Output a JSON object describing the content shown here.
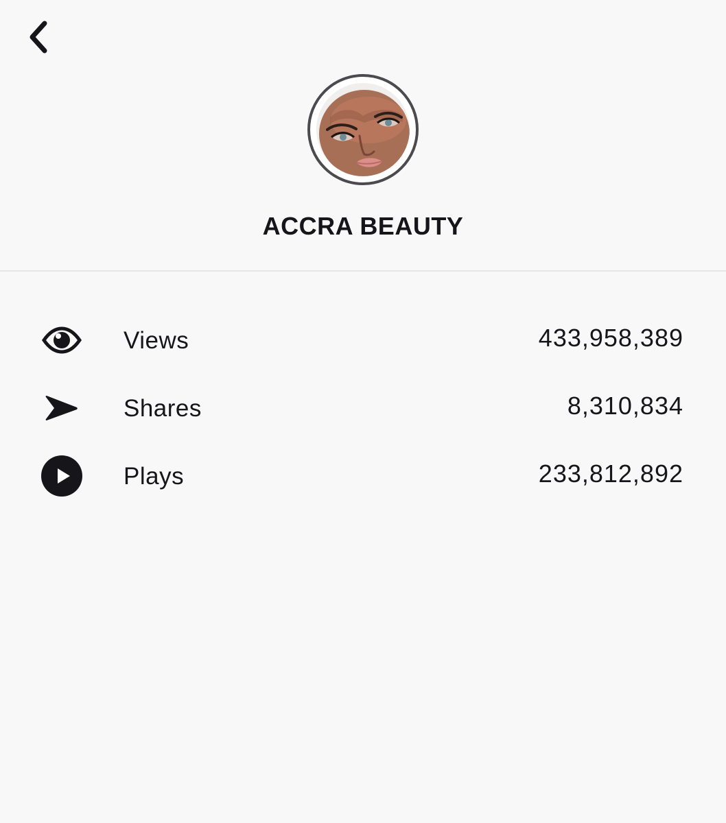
{
  "header": {
    "back_icon": "chevron-left-icon"
  },
  "profile": {
    "name": "ACCRA BEAUTY",
    "avatar_ring_color": "#4a4a4f"
  },
  "stats": [
    {
      "icon": "eye-icon",
      "label": "Views",
      "value": "433,958,389"
    },
    {
      "icon": "share-arrow-icon",
      "label": "Shares",
      "value": "8,310,834"
    },
    {
      "icon": "play-circle-icon",
      "label": "Plays",
      "value": "233,812,892"
    }
  ],
  "colors": {
    "background": "#f8f8f8",
    "text": "#16161a",
    "divider": "#e6e6e6"
  }
}
